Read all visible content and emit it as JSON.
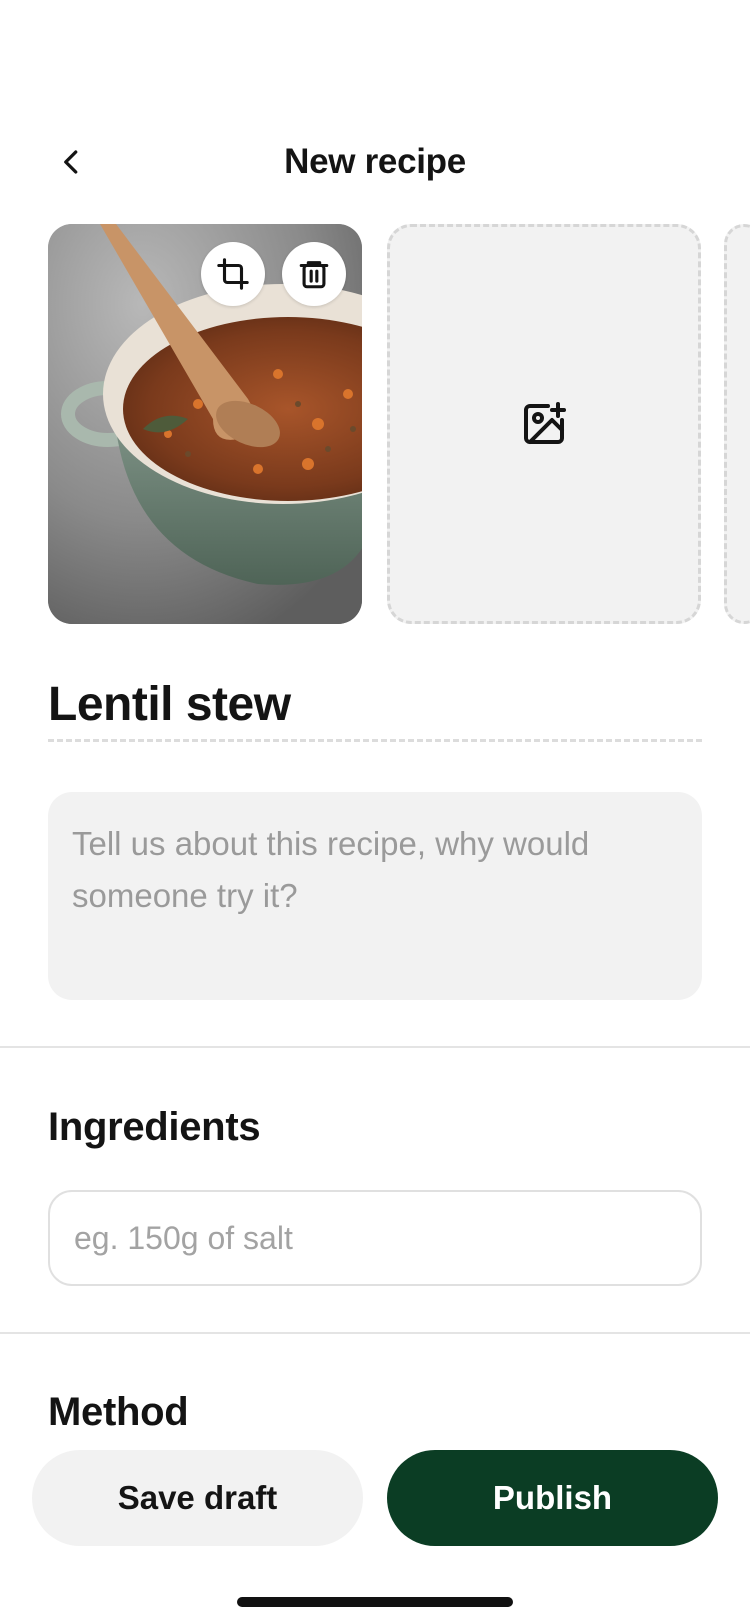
{
  "header": {
    "title": "New recipe",
    "back_icon": "chevron-left-icon"
  },
  "photos": {
    "main_alt": "Pot of lentil stew with wooden spoon",
    "crop_icon": "crop-icon",
    "delete_icon": "trash-icon",
    "add_icon": "image-add-icon"
  },
  "recipe": {
    "title": "Lentil stew"
  },
  "description": {
    "placeholder": "Tell us about this recipe, why would someone try it?"
  },
  "ingredients": {
    "heading": "Ingredients",
    "placeholder": "eg. 150g of salt",
    "value": ""
  },
  "method": {
    "heading": "Method"
  },
  "actions": {
    "save_draft": "Save draft",
    "publish": "Publish"
  },
  "colors": {
    "accent": "#0b3d24",
    "surface": "#f2f2f2",
    "text": "#141414",
    "placeholder": "#9a9a9a"
  }
}
